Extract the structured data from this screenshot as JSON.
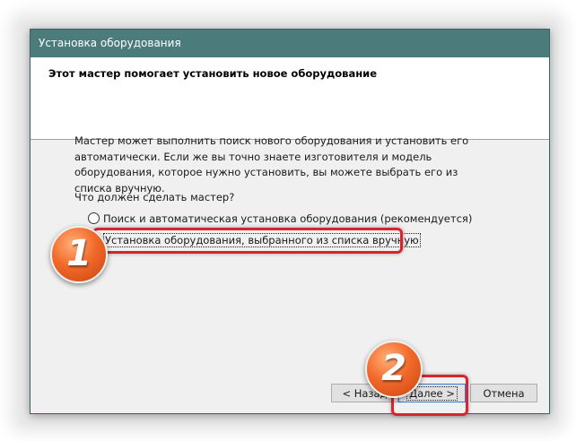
{
  "window": {
    "title": "Установка оборудования",
    "header_title": "Этот мастер помогает установить новое оборудование"
  },
  "content": {
    "description": "Мастер может выполнить поиск нового оборудования и установить его автоматически. Если же вы точно знаете изготовителя и модель оборудования, которое нужно установить, вы можете выбрать его из списка вручную.",
    "question": "Что должен сделать мастер?",
    "options": [
      {
        "label": "Поиск и автоматическая установка оборудования (рекомендуется)",
        "checked": false
      },
      {
        "label": "Установка оборудования, выбранного из списка вручную",
        "checked": true
      }
    ]
  },
  "buttons": {
    "back": "< Назад",
    "next": "Далее >",
    "cancel": "Отмена"
  },
  "annotations": {
    "marker1": "1",
    "marker2": "2",
    "highlight_color": "#d9232e",
    "marker_color": "#f26a2a"
  }
}
